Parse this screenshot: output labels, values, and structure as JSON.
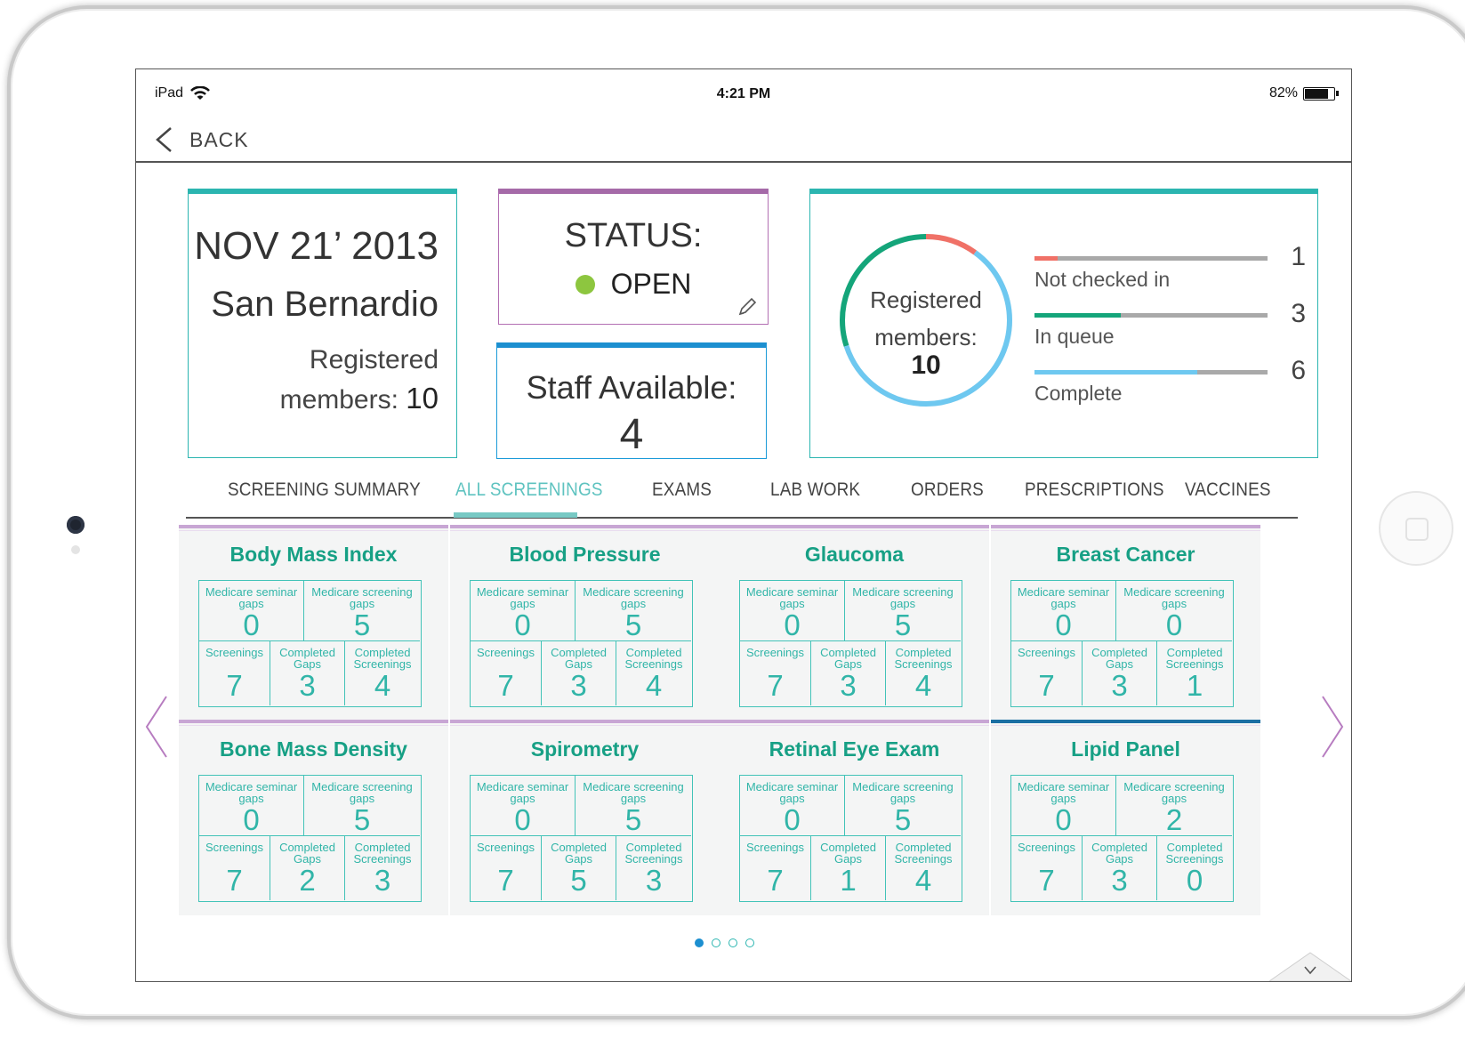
{
  "status_bar": {
    "carrier": "iPad",
    "time": "4:21 PM",
    "battery": "82%",
    "battery_level": 0.82
  },
  "nav": {
    "back_label": "BACK"
  },
  "event": {
    "date": "NOV 21’ 2013",
    "location": "San Bernardio",
    "registered_label_1": "Registered",
    "registered_label_2": "members:",
    "registered_value": "10"
  },
  "status": {
    "title": "STATUS:",
    "value": "OPEN",
    "dot_color": "#8dc63f"
  },
  "staff": {
    "label": "Staff Available:",
    "value": "4"
  },
  "progress": {
    "donut_label_1": "Registered",
    "donut_label_2": "members:",
    "total": "10",
    "rows": [
      {
        "label": "Not checked in",
        "value": "1",
        "fraction": 0.1,
        "color": "#f07167"
      },
      {
        "label": "In queue",
        "value": "3",
        "fraction": 0.37,
        "color": "#14a57a"
      },
      {
        "label": "Complete",
        "value": "6",
        "fraction": 0.7,
        "color": "#6ec8f0"
      }
    ]
  },
  "tabs": [
    {
      "label": "SCREENING SUMMARY",
      "active": false
    },
    {
      "label": "ALL SCREENINGS",
      "active": true
    },
    {
      "label": "EXAMS",
      "active": false
    },
    {
      "label": "LAB WORK",
      "active": false
    },
    {
      "label": "ORDERS",
      "active": false
    },
    {
      "label": "PRESCRIPTIONS",
      "active": false
    },
    {
      "label": "VACCINES",
      "active": false
    }
  ],
  "labels": {
    "seminar_gaps": "Medicare seminar gaps",
    "screening_gaps": "Medicare screening gaps",
    "screenings": "Screenings",
    "completed_gaps": "Completed Gaps",
    "completed_screenings": "Completed Screenings"
  },
  "screenings": [
    {
      "title": "Body Mass Index",
      "seminar_gaps": "0",
      "screening_gaps": "5",
      "screenings": "7",
      "completed_gaps": "3",
      "completed_screenings": "4"
    },
    {
      "title": "Blood Pressure",
      "seminar_gaps": "0",
      "screening_gaps": "5",
      "screenings": "7",
      "completed_gaps": "3",
      "completed_screenings": "4"
    },
    {
      "title": "Glaucoma",
      "seminar_gaps": "0",
      "screening_gaps": "5",
      "screenings": "7",
      "completed_gaps": "3",
      "completed_screenings": "4"
    },
    {
      "title": "Breast Cancer",
      "seminar_gaps": "0",
      "screening_gaps": "0",
      "screenings": "7",
      "completed_gaps": "3",
      "completed_screenings": "1"
    },
    {
      "title": "Bone Mass Density",
      "seminar_gaps": "0",
      "screening_gaps": "5",
      "screenings": "7",
      "completed_gaps": "2",
      "completed_screenings": "3"
    },
    {
      "title": "Spirometry",
      "seminar_gaps": "0",
      "screening_gaps": "5",
      "screenings": "7",
      "completed_gaps": "5",
      "completed_screenings": "3"
    },
    {
      "title": "Retinal Eye Exam",
      "seminar_gaps": "0",
      "screening_gaps": "5",
      "screenings": "7",
      "completed_gaps": "1",
      "completed_screenings": "4"
    },
    {
      "title": "Lipid Panel",
      "seminar_gaps": "0",
      "screening_gaps": "2",
      "screenings": "7",
      "completed_gaps": "3",
      "completed_screenings": "0"
    }
  ],
  "pager": {
    "pages": 4,
    "current": 1
  },
  "icons": {
    "back": "chevron-left-icon",
    "wifi": "wifi-icon",
    "battery": "battery-icon",
    "edit": "pencil-icon",
    "prev": "chevron-left-icon",
    "next": "chevron-right-icon",
    "collapse": "chevron-down-icon"
  }
}
